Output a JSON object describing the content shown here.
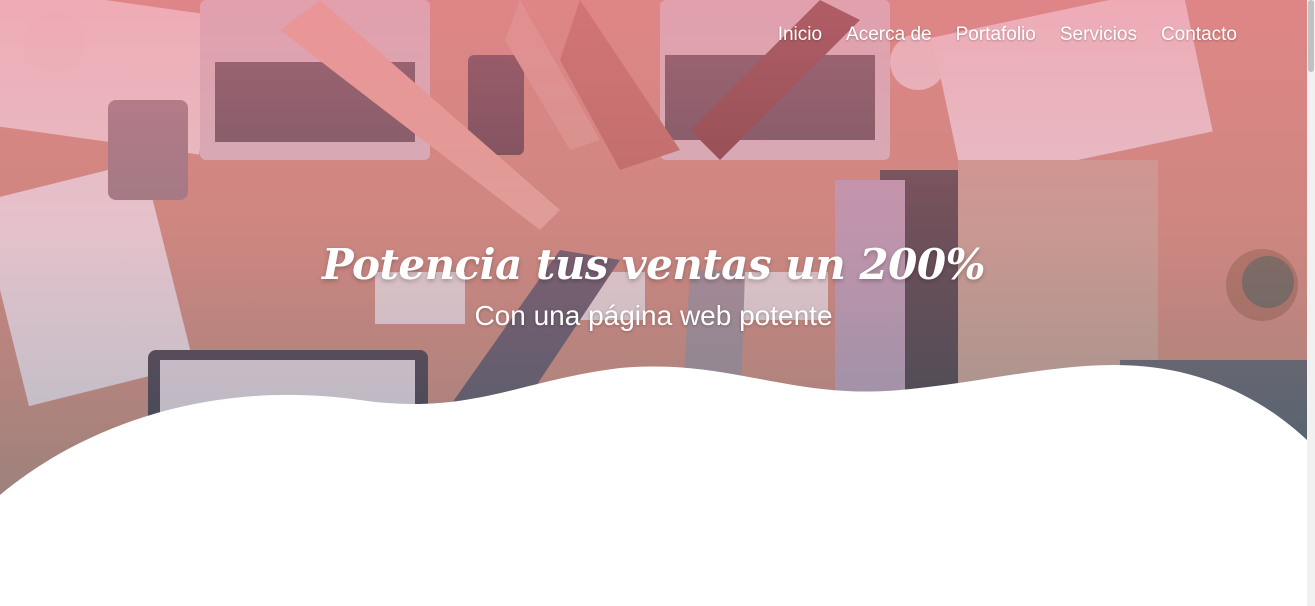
{
  "nav": {
    "items": [
      {
        "label": "Inicio"
      },
      {
        "label": "Acerca de"
      },
      {
        "label": "Portafolio"
      },
      {
        "label": "Servicios"
      },
      {
        "label": "Contacto"
      }
    ]
  },
  "hero": {
    "title": "Potencia tus ventas un 200%",
    "subtitle": "Con una página web potente"
  },
  "colors": {
    "overlay_pink": "#ec7a8c",
    "text": "#ffffff",
    "wave": "#ffffff"
  }
}
